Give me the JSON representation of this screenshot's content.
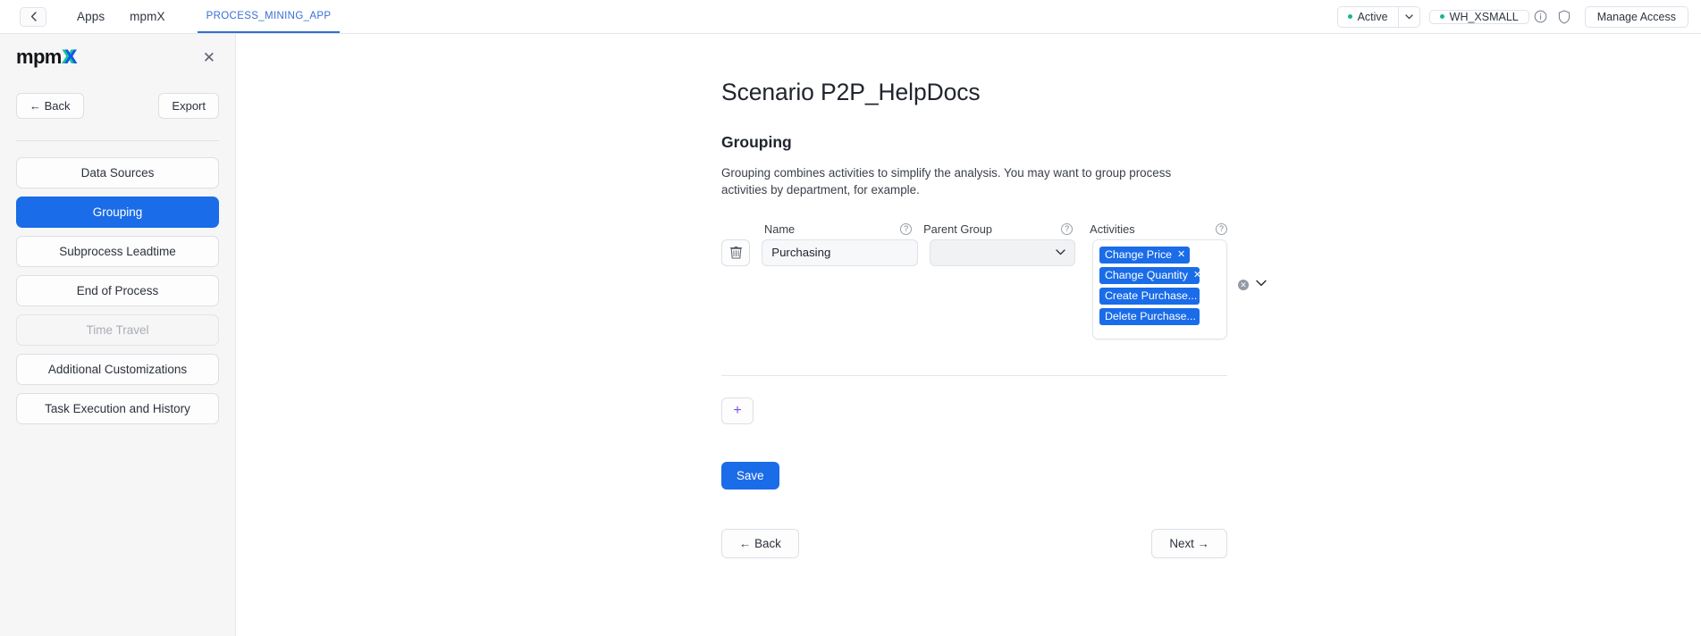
{
  "topbar": {
    "back_icon": "chevron-left-icon",
    "breadcrumbs": [
      {
        "label": "Apps",
        "active": false
      },
      {
        "label": "mpmX",
        "active": false
      },
      {
        "label": "PROCESS_MINING_APP",
        "active": true
      }
    ],
    "status_label": "Active",
    "status_caret": "⌄",
    "warehouse_label": "WH_XSMALL",
    "info_icon": "info-circle-icon",
    "shield_icon": "shield-icon",
    "manage_access_label": "Manage Access",
    "accent_dot_color": "#18b888",
    "active_tab_color": "#3b6fd4"
  },
  "sidebar": {
    "logo_text_dark": "mpm",
    "logo_x_green": "X",
    "logo_x_blue": "X",
    "close_icon": "close-icon",
    "back_label": "← Back",
    "export_label": "Export",
    "items": [
      {
        "label": "Data Sources",
        "state": "default"
      },
      {
        "label": "Grouping",
        "state": "selected"
      },
      {
        "label": "Subprocess Leadtime",
        "state": "default"
      },
      {
        "label": "End of Process",
        "state": "default"
      },
      {
        "label": "Time Travel",
        "state": "disabled"
      },
      {
        "label": "Additional Customizations",
        "state": "default"
      },
      {
        "label": "Task Execution and History",
        "state": "default"
      }
    ],
    "selected_color": "#1a6ce8"
  },
  "main": {
    "page_title": "Scenario P2P_HelpDocs",
    "section_title": "Grouping",
    "section_desc": "Grouping combines activities to simplify the analysis. You may want to group process activities by department, for example.",
    "columns": [
      {
        "label": "Name",
        "help_icon": "help-circle-icon"
      },
      {
        "label": "Parent Group",
        "help_icon": "help-circle-icon"
      },
      {
        "label": "Activities",
        "help_icon": "help-circle-icon"
      }
    ],
    "row": {
      "delete_icon": "trash-icon",
      "name_value": "Purchasing",
      "name_placeholder": "",
      "parent_group_value": "",
      "parent_group_caret": "⌄",
      "activities": [
        {
          "label": "Change Price",
          "removable": true,
          "remove_icon": "close-icon"
        },
        {
          "label": "Change Quantity",
          "removable": true,
          "remove_icon": "close-icon"
        },
        {
          "label": "Create Purchase...",
          "removable": true,
          "remove_icon": "close-icon"
        },
        {
          "label": "Delete Purchase...",
          "removable": true,
          "remove_icon": "close-icon"
        }
      ],
      "clear_all_icon": "clear-circle-icon",
      "dropdown_caret": "⌄",
      "tag_color": "#1a6ce8"
    },
    "add_row_label": "+",
    "add_row_color": "#7c4ddb",
    "save_label": "Save",
    "save_color": "#1a6ce8",
    "footer_back_label": "← Back",
    "footer_next_label": "Next →"
  }
}
